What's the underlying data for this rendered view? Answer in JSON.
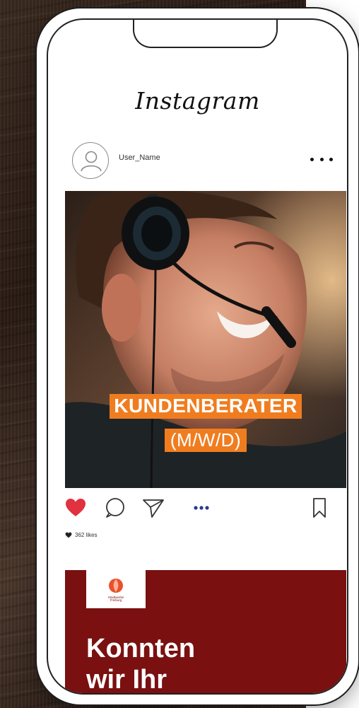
{
  "app": {
    "title": "Instagram"
  },
  "post": {
    "username": "User_Name",
    "job_title": "KUNDENBERATER",
    "job_subtitle": "(M/W/D)",
    "likes_text": "362 likes"
  },
  "promo": {
    "logo_text": "Stadtwerke\nFreiburg",
    "headline": "Konnten\nwir Ihr"
  },
  "colors": {
    "accent_orange": "#ef7d20",
    "promo_red": "#7a1010",
    "heart_red": "#e0323f"
  },
  "icons": {
    "like": "heart-icon",
    "comment": "comment-icon",
    "share": "send-icon",
    "more": "more-dots-icon",
    "save": "bookmark-icon",
    "avatar": "user-icon"
  }
}
